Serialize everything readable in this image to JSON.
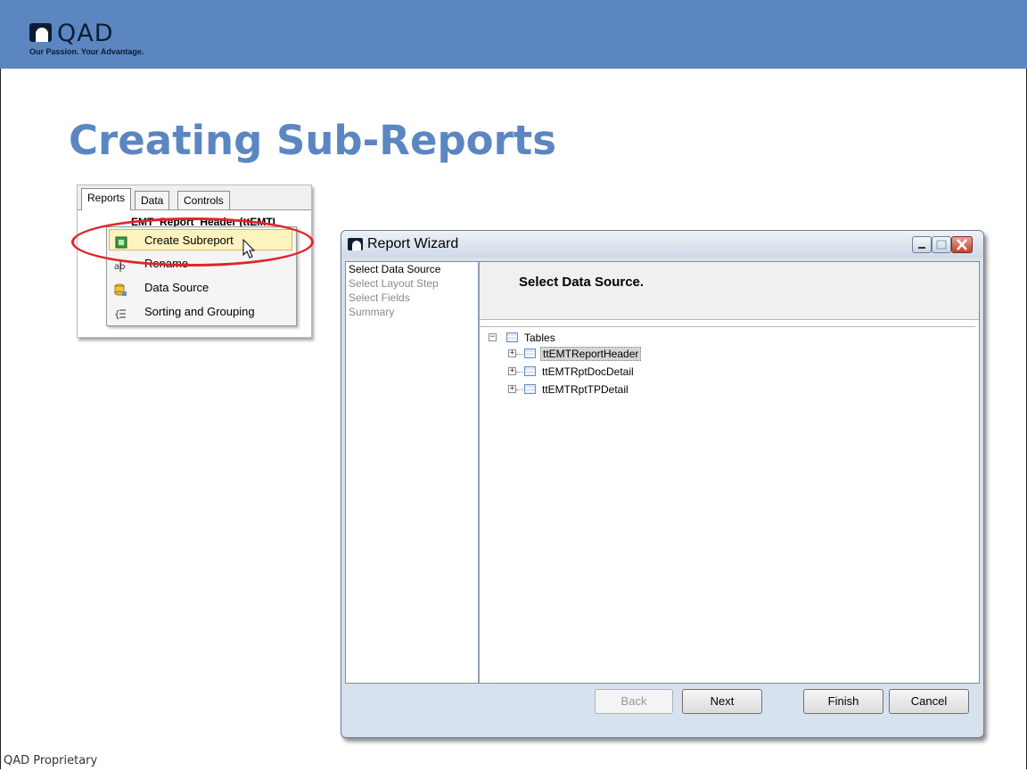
{
  "brand": {
    "name": "QAD",
    "tagline": "Our Passion. Your Advantage."
  },
  "slide": {
    "title": "Creating Sub-Reports",
    "footer": "QAD Proprietary"
  },
  "context_panel": {
    "tabs": [
      "Reports",
      "Data",
      "Controls"
    ],
    "active_tab": "Reports",
    "tree_item": "EMT_Report_Header (ttEMTI",
    "menu_items": [
      {
        "label": "Create Subreport",
        "icon": "subreport-icon",
        "highlighted": true
      },
      {
        "label": "Rename",
        "icon": "rename-icon",
        "highlighted": false
      },
      {
        "label": "Data Source",
        "icon": "database-icon",
        "highlighted": false
      },
      {
        "label": "Sorting and Grouping",
        "icon": "sort-group-icon",
        "highlighted": false
      }
    ]
  },
  "wizard": {
    "title": "Report Wizard",
    "steps": [
      {
        "label": "Select Data Source",
        "current": true
      },
      {
        "label": "Select Layout Step",
        "current": false
      },
      {
        "label": "Select Fields",
        "current": false
      },
      {
        "label": "Summary",
        "current": false
      }
    ],
    "header": "Select Data Source.",
    "tree": {
      "root": "Tables",
      "children": [
        "ttEMTReportHeader",
        "ttEMTRptDocDetail",
        "ttEMTRptTPDetail"
      ],
      "selected": "ttEMTReportHeader"
    },
    "buttons": {
      "back": "Back",
      "next": "Next",
      "finish": "Finish",
      "cancel": "Cancel"
    }
  },
  "colors": {
    "brand_blue": "#5b86c1",
    "highlight_oval": "#e2242a",
    "menu_highlight": "#fdf3bf"
  }
}
